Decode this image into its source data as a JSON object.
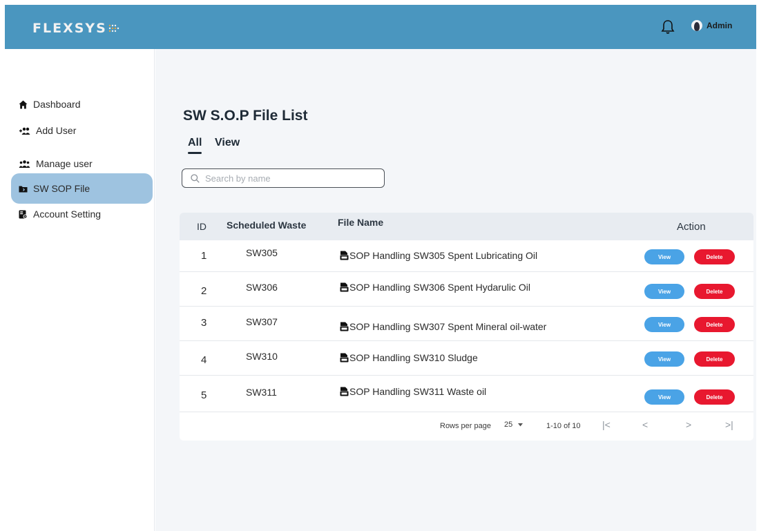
{
  "header": {
    "logo_text": "FLEXSYS",
    "user_name": "Admin",
    "bar_color": "#4a96bf"
  },
  "sidebar": {
    "items": [
      {
        "label": "Dashboard",
        "icon": "home-icon"
      },
      {
        "label": "Add User",
        "icon": "add-user-icon"
      },
      {
        "label": "Manage user",
        "icon": "users-icon"
      },
      {
        "label": "SW SOP File",
        "icon": "folder-icon",
        "active": true
      },
      {
        "label": "Account Setting",
        "icon": "settings-badge-icon"
      }
    ],
    "active_color": "#9ec3e0"
  },
  "main": {
    "title": "SW S.O.P File List",
    "tabs": [
      {
        "label": "All",
        "active": true
      },
      {
        "label": "View",
        "active": false
      }
    ],
    "search": {
      "placeholder": "Search by name",
      "value": ""
    }
  },
  "table": {
    "columns": [
      "ID",
      "Scheduled Waste",
      "File Name",
      "Action"
    ],
    "rows": [
      {
        "id": "1",
        "waste": "SW305",
        "file": "SOP Handling SW305 Spent Lubricating Oil"
      },
      {
        "id": "2",
        "waste": "SW306",
        "file": "SOP Handling SW306 Spent Hydarulic Oil"
      },
      {
        "id": "3",
        "waste": "SW307",
        "file": "SOP Handling SW307 Spent Mineral oil-water"
      },
      {
        "id": "4",
        "waste": "SW310",
        "file": "SOP Handling SW310 Sludge"
      },
      {
        "id": "5",
        "waste": "SW311",
        "file": "SOP Handling SW311 Waste oil"
      }
    ],
    "view_label": "View",
    "delete_label": "Delete",
    "view_color": "#4aa3e6",
    "delete_color": "#e8182f"
  },
  "pagination": {
    "rows_per_page_label": "Rows per page",
    "rows_per_page_value": "25",
    "range": "1-10 of 10",
    "first": "|<",
    "prev": "<",
    "next": ">",
    "last": ">|"
  }
}
